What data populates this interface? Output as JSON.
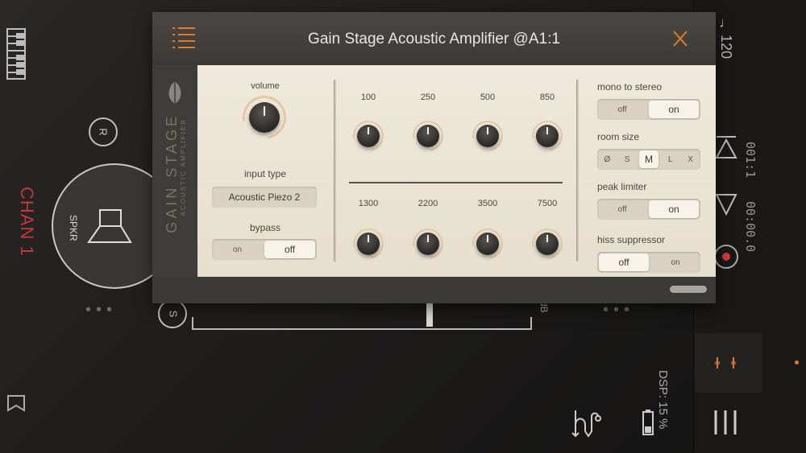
{
  "host": {
    "channel_label": "CHAN 1",
    "r_button": "R",
    "s_button": "S",
    "speaker_label": "SPKR",
    "tempo": "♩ 120",
    "bar_position": "001:1",
    "time_position": "00:00.0",
    "dsp_label": "DSP: 15 %",
    "db_label": "dB",
    "accent_color": "#e07a2d",
    "record_color": "#d33a3a"
  },
  "plugin": {
    "title": "Gain Stage Acoustic Amplifier @A1:1",
    "side_brand": "GAIN STAGE",
    "side_sub": "ACOUSTIC AMPLIFIER",
    "volume_label": "volume",
    "input_type_label": "input type",
    "input_type_value": "Acoustic Piezo 2",
    "bypass_label": "bypass",
    "bypass_on": "on",
    "bypass_off": "off",
    "eq_top": [
      "100",
      "250",
      "500",
      "850"
    ],
    "eq_bottom": [
      "1300",
      "2200",
      "3500",
      "7500"
    ],
    "mono_label": "mono to stereo",
    "mono_off": "off",
    "mono_on": "on",
    "room_label": "room size",
    "room_options": [
      "Ø",
      "S",
      "M",
      "L",
      "X"
    ],
    "room_selected": "M",
    "limiter_label": "peak limiter",
    "limiter_off": "off",
    "limiter_on": "on",
    "hiss_label": "hiss suppressor",
    "hiss_off": "off",
    "hiss_on": "on"
  }
}
